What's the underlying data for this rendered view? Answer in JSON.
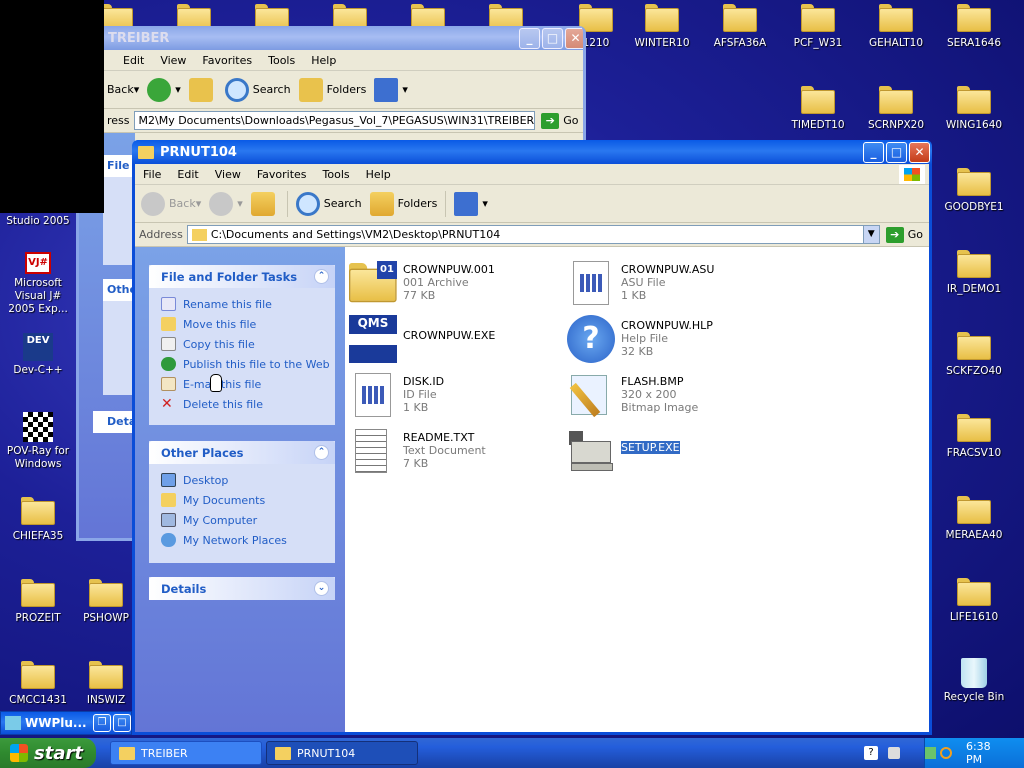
{
  "desktop": {
    "left_icons": [
      {
        "label": "Studio 2005"
      },
      {
        "label": "Microsoft Visual J# 2005 Exp..."
      },
      {
        "label": "Dev-C++"
      },
      {
        "label": "POV-Ray for Windows"
      },
      {
        "label": "CHIEFA35"
      },
      {
        "label": "PROZEIT"
      },
      {
        "label": "PSHOWP"
      },
      {
        "label": "CMCC1431"
      },
      {
        "label": "INSWIZ"
      }
    ],
    "top_icons": [
      {
        "label": "1210"
      },
      {
        "label": "WINTER10"
      },
      {
        "label": "AFSFA36A"
      },
      {
        "label": "PCF_W31"
      },
      {
        "label": "GEHALT10"
      },
      {
        "label": "SERA1646"
      },
      {
        "label": "TIMEDT10"
      },
      {
        "label": "SCRNPX20"
      },
      {
        "label": "WING1640"
      }
    ],
    "right_icons": [
      {
        "label": "GOODBYE1"
      },
      {
        "label": "IR_DEMO1"
      },
      {
        "label": "SCKFZO40"
      },
      {
        "label": "FRACSV10"
      },
      {
        "label": "MERAEA40"
      },
      {
        "label": "LIFE1610"
      },
      {
        "label": "Recycle Bin"
      }
    ]
  },
  "back_window": {
    "title": "TREIBER",
    "menu": [
      "Edit",
      "View",
      "Favorites",
      "Tools",
      "Help"
    ],
    "back_label": "Back",
    "search_label": "Search",
    "folders_label": "Folders",
    "address_label": "ress",
    "address": "M2\\My Documents\\Downloads\\Pegasus_Vol_7\\PEGASUS\\WIN31\\TREIBER",
    "go_label": "Go",
    "panel_a": "File a",
    "panel_other": "Othe",
    "panel_details": "Deta"
  },
  "window": {
    "title": "PRNUT104",
    "menu": [
      "File",
      "Edit",
      "View",
      "Favorites",
      "Tools",
      "Help"
    ],
    "toolbar": {
      "back": "Back",
      "search": "Search",
      "folders": "Folders"
    },
    "address_label": "Address",
    "address": "C:\\Documents and Settings\\VM2\\Desktop\\PRNUT104",
    "go_label": "Go",
    "tasks": {
      "title": "File and Folder Tasks",
      "items": [
        "Rename this file",
        "Move this file",
        "Copy this file",
        "Publish this file to the Web",
        "E-mail this file",
        "Delete this file"
      ]
    },
    "places": {
      "title": "Other Places",
      "items": [
        "Desktop",
        "My Documents",
        "My Computer",
        "My Network Places"
      ]
    },
    "details": {
      "title": "Details"
    },
    "files": [
      {
        "name": "CROWNPUW.001",
        "type": "001 Archive",
        "size": "77 KB"
      },
      {
        "name": "CROWNPUW.ASU",
        "type": "ASU File",
        "size": "1 KB"
      },
      {
        "name": "CROWNPUW.EXE",
        "type": "",
        "size": ""
      },
      {
        "name": "CROWNPUW.HLP",
        "type": "Help File",
        "size": "32 KB"
      },
      {
        "name": "DISK.ID",
        "type": "ID File",
        "size": "1 KB"
      },
      {
        "name": "FLASH.BMP",
        "type": "320 x 200",
        "size": "Bitmap Image"
      },
      {
        "name": "README.TXT",
        "type": "Text Document",
        "size": "7 KB"
      },
      {
        "name": "SETUP.EXE",
        "type": "",
        "size": ""
      }
    ]
  },
  "small_window": {
    "title": "WWPlu..."
  },
  "taskbar": {
    "start_label": "start",
    "tasks": [
      "TREIBER",
      "PRNUT104"
    ],
    "clock": "6:38 PM"
  },
  "colors": {
    "title_blue": "#0a5ae6",
    "task_link": "#215dc6",
    "selection": "#316ac5"
  }
}
